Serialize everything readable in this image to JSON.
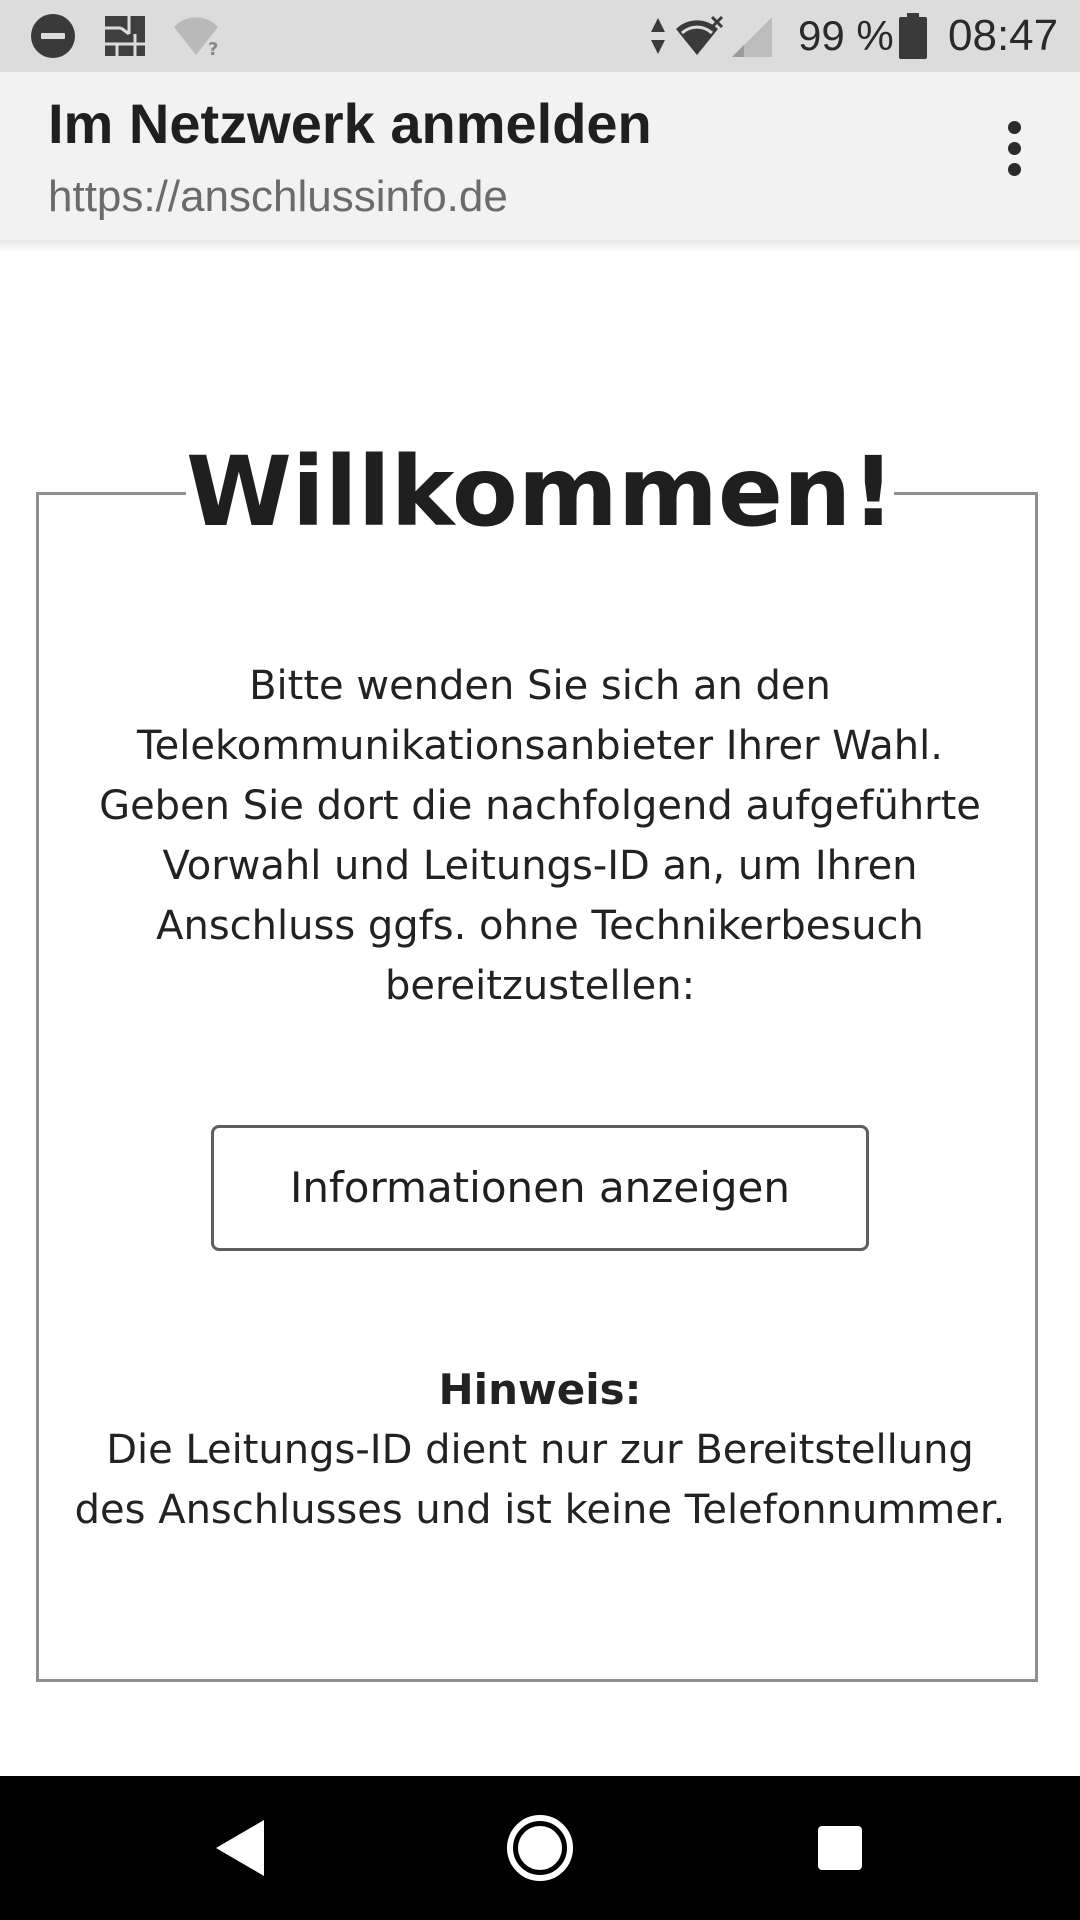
{
  "status_bar": {
    "battery_percent": "99 %",
    "time": "08:47",
    "icons": [
      "do-not-disturb-icon",
      "app-notification-icon",
      "wifi-unknown-icon",
      "data-arrows-icon",
      "wifi-icon",
      "cellular-signal-icon",
      "battery-icon"
    ]
  },
  "header": {
    "title": "Im Netzwerk anmelden",
    "url": "https://anschlussinfo.de",
    "menu_icon": "more-vert-icon"
  },
  "main": {
    "welcome_title": "Willkommen!",
    "intro_lines": [
      "Bitte wenden Sie sich an den",
      "Telekommunikationsanbieter Ihrer Wahl.",
      "Geben Sie dort die nachfolgend aufgeführte",
      "Vorwahl und Leitungs-ID an, um Ihren",
      "Anschluss ggfs. ohne Technikerbesuch",
      "bereitzustellen:"
    ],
    "info_button_label": "Informationen anzeigen",
    "note_heading": "Hinweis:",
    "note_lines": [
      "Die Leitungs-ID dient nur zur Bereitstellung",
      "des Anschlusses und ist keine Telefonnummer."
    ]
  },
  "nav_bar": {
    "icons": [
      "back-icon",
      "home-icon",
      "recents-icon"
    ]
  },
  "colors": {
    "status_bar_bg": "#dcdcdc",
    "title_bar_bg": "#f2f2f2",
    "box_border": "#8f8f8f",
    "nav_bar_bg": "#000000"
  }
}
